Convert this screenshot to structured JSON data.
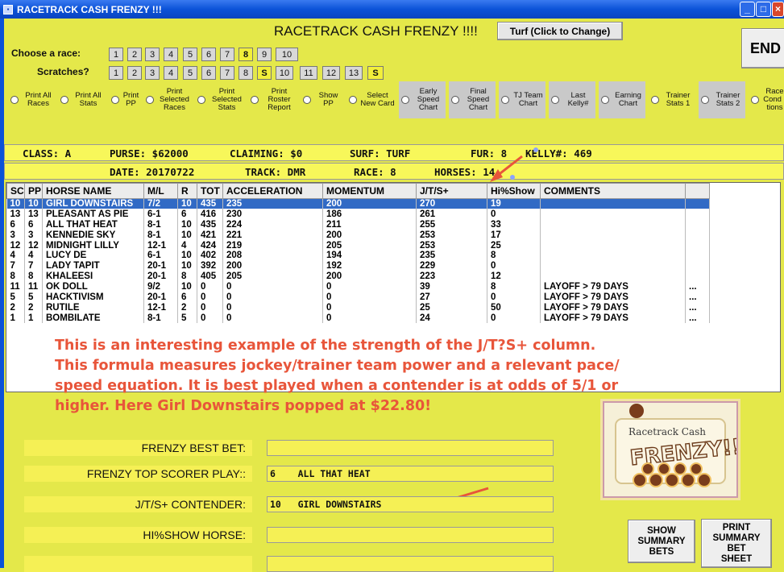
{
  "window": {
    "title": "RACETRACK CASH FRENZY !!!"
  },
  "header": {
    "app_title": "RACETRACK CASH FRENZY !!!!",
    "turf_button": "Turf (Click to Change)",
    "end_button": "END"
  },
  "choose_race": {
    "label": "Choose  a race:",
    "buttons": [
      "1",
      "2",
      "3",
      "4",
      "5",
      "6",
      "7",
      "8",
      "9",
      "10"
    ]
  },
  "scratches": {
    "label": "Scratches?",
    "buttons": [
      "1",
      "2",
      "3",
      "4",
      "5",
      "6",
      "7",
      "8",
      "S",
      "10",
      "11",
      "12",
      "13",
      "S"
    ]
  },
  "options": [
    "Print All Races",
    "Print All Stats",
    "Print PP",
    "Print Selected Races",
    "Print Selected Stats",
    "Print Roster Report",
    "Show PP",
    "Select New Card",
    "Early Speed Chart",
    "Final Speed Chart",
    "TJ Team Chart",
    "Last Kelly#",
    "Earning Chart",
    "Trainer Stats 1",
    "Trainer Stats 2",
    "Race Cond -tions"
  ],
  "info1": {
    "class": "CLASS: A",
    "purse": "PURSE: $62000",
    "claiming": "CLAIMING: $0",
    "surf": "SURF: TURF",
    "fur": "FUR: 8",
    "kelly": "KELLY#: 469"
  },
  "info2": {
    "date": "DATE: 20170722",
    "track": "TRACK: DMR",
    "race": "RACE: 8",
    "horses": "HORSES: 14"
  },
  "grid": {
    "columns": [
      "SC",
      "PP",
      "HORSE NAME",
      "M/L",
      "R",
      "TOT",
      "ACCELERATION",
      "MOMENTUM",
      "J/T/S+",
      "Hi%Show",
      "COMMENTS"
    ],
    "rows": [
      [
        "10",
        "10",
        "GIRL DOWNSTAIRS",
        "7/2",
        "10",
        "435",
        "235",
        "200",
        "270",
        "19",
        "",
        ""
      ],
      [
        "13",
        "13",
        "PLEASANT AS PIE",
        "6-1",
        "6",
        "416",
        "230",
        "186",
        "261",
        "0",
        "",
        ""
      ],
      [
        "6",
        "6",
        "ALL THAT HEAT",
        "8-1",
        "10",
        "435",
        "224",
        "211",
        "255",
        "33",
        "",
        ""
      ],
      [
        "3",
        "3",
        "KENNEDIE SKY",
        "8-1",
        "10",
        "421",
        "221",
        "200",
        "253",
        "17",
        "",
        ""
      ],
      [
        "12",
        "12",
        "MIDNIGHT LILLY",
        "12-1",
        "4",
        "424",
        "219",
        "205",
        "253",
        "25",
        "",
        ""
      ],
      [
        "4",
        "4",
        "LUCY DE",
        "6-1",
        "10",
        "402",
        "208",
        "194",
        "235",
        "8",
        "",
        ""
      ],
      [
        "7",
        "7",
        "LADY TAPIT",
        "20-1",
        "10",
        "392",
        "200",
        "192",
        "229",
        "0",
        "",
        ""
      ],
      [
        "8",
        "8",
        "KHALEESI",
        "20-1",
        "8",
        "405",
        "205",
        "200",
        "223",
        "12",
        "",
        ""
      ],
      [
        "11",
        "11",
        "OK DOLL",
        "9/2",
        "10",
        "0",
        "0",
        "0",
        "39",
        "8",
        "LAYOFF > 79 DAYS",
        "..."
      ],
      [
        "5",
        "5",
        "HACKTIVISM",
        "20-1",
        "6",
        "0",
        "0",
        "0",
        "27",
        "0",
        "LAYOFF > 79 DAYS",
        "..."
      ],
      [
        "2",
        "2",
        "RUTILE",
        "12-1",
        "2",
        "0",
        "0",
        "0",
        "25",
        "50",
        "LAYOFF > 79 DAYS",
        "..."
      ],
      [
        "1",
        "1",
        "BOMBILATE",
        "8-1",
        "5",
        "0",
        "0",
        "0",
        "24",
        "0",
        "LAYOFF > 79 DAYS",
        "..."
      ]
    ]
  },
  "annotation": {
    "line1": "This is an interesting example of the strength of the J/T?S+ column.",
    "line2": "This formula measures jockey/trainer team power and a relevant pace/",
    "line3": "speed equation.  It is best played when a contender is at odds of 5/1 or",
    "line4": "higher.  Here Girl Downstairs popped at $22.80!"
  },
  "plays": {
    "best_bet_label": "FRENZY BEST BET:",
    "best_bet_value": "",
    "top_scorer_label": "FRENZY TOP SCORER PLAY::",
    "top_scorer_value": "6    ALL THAT HEAT",
    "jts_label": "J/T/S+ CONTENDER:",
    "jts_value": "10   GIRL DOWNSTAIRS",
    "hishow_label": "HI%SHOW HORSE:",
    "hishow_value": "",
    "extra_value": ""
  },
  "buttons": {
    "show_summary": [
      "SHOW",
      "SUMMARY",
      "BETS"
    ],
    "print_summary": [
      "PRINT",
      "SUMMARY",
      "BET",
      "SHEET"
    ]
  },
  "logo": {
    "line1": "Racetrack Cash",
    "line2": "FRENZY!!"
  },
  "colors": {
    "background": "#e4e84a",
    "annotation": "#e8553a",
    "selection": "#316ac5",
    "titlebar": "#0b52d8"
  }
}
